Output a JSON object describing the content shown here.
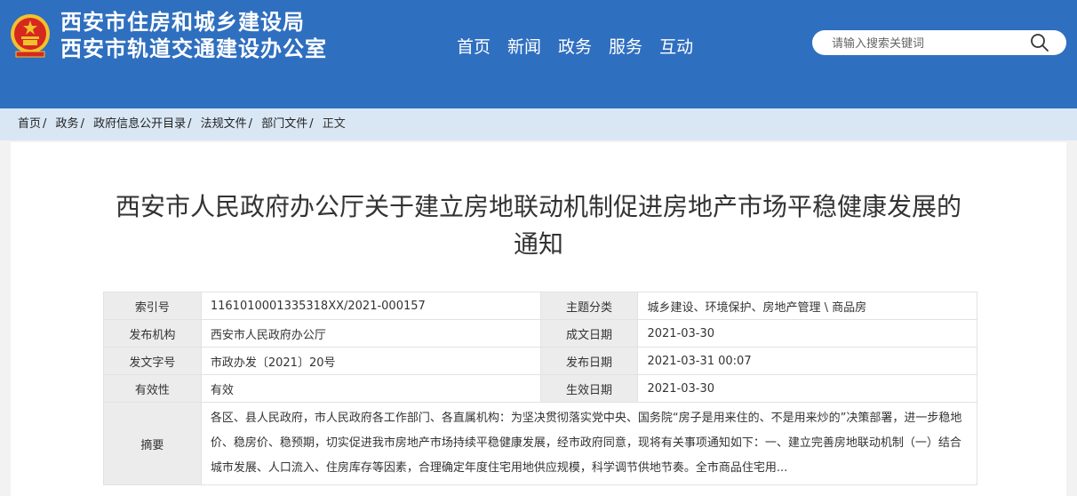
{
  "header": {
    "title_line1": "西安市住房和城乡建设局",
    "title_line2": "西安市轨道交通建设办公室",
    "nav": [
      "首页",
      "新闻",
      "政务",
      "服务",
      "互动"
    ],
    "search_placeholder": "请输入搜索关键词",
    "colors": {
      "header_bg": "#2f6fbf",
      "emblem_red": "#d6281f",
      "emblem_gold": "#f2c12e"
    }
  },
  "breadcrumb": [
    "首页",
    "政务",
    "政府信息公开目录",
    "法规文件",
    "部门文件",
    "正文"
  ],
  "doc": {
    "title_line1": "西安市人民政府办公厅关于建立房地联动机制促进房地产市场平稳健康发展的",
    "title_line2": "通知",
    "meta": {
      "index_label": "索引号",
      "index_value": "1161010001335318XX/2021-000157",
      "topic_label": "主题分类",
      "topic_value": "城乡建设、环境保护、房地产管理 \\ 商品房",
      "issuer_label": "发布机构",
      "issuer_value": "西安市人民政府办公厅",
      "created_label": "成文日期",
      "created_value": "2021-03-30",
      "docno_label": "发文字号",
      "docno_value": "市政办发〔2021〕20号",
      "published_label": "发布日期",
      "published_value": "2021-03-31 00:07",
      "validity_label": "有效性",
      "validity_value": "有效",
      "effective_label": "生效日期",
      "effective_value": "2021-03-30",
      "abstract_label": "摘要",
      "abstract_value": "各区、县人民政府，市人民政府各工作部门、各直属机构：为坚决贯彻落实党中央、国务院“房子是用来住的、不是用来炒的”决策部署，进一步稳地价、稳房价、稳预期，切实促进我市房地产市场持续平稳健康发展，经市政府同意，现将有关事项通知如下：一、建立完善房地联动机制（一）结合城市发展、人口流入、住房库存等因素，合理确定年度住宅用地供应规模，科学调节供地节奏。全市商品住宅用..."
    }
  }
}
